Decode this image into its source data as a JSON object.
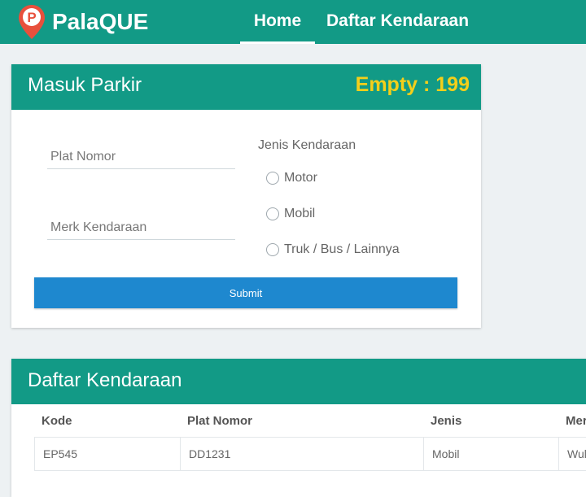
{
  "brand": {
    "name": "PalaQUE",
    "logo_icon": "parking-pin-icon",
    "logo_color": "#e8503c"
  },
  "nav": {
    "home": "Home",
    "daftar": "Daftar Kendaraan"
  },
  "form": {
    "title": "Masuk Parkir",
    "empty_label": "Empty : 199",
    "plat_placeholder": "Plat Nomor",
    "merk_placeholder": "Merk Kendaraan",
    "jenis_title": "Jenis Kendaraan",
    "radio_options": [
      "Motor",
      "Mobil",
      "Truk / Bus / Lainnya"
    ],
    "submit_label": "Submit"
  },
  "list": {
    "title": "Daftar Kendaraan",
    "columns": [
      "Kode",
      "Plat Nomor",
      "Jenis",
      "Mer"
    ],
    "rows": [
      [
        "EP545",
        "DD1231",
        "Mobil",
        "Wul"
      ]
    ]
  },
  "colors": {
    "primary": "#129a86",
    "accent_yellow": "#f4cf1a",
    "button_blue": "#1e88cf"
  }
}
